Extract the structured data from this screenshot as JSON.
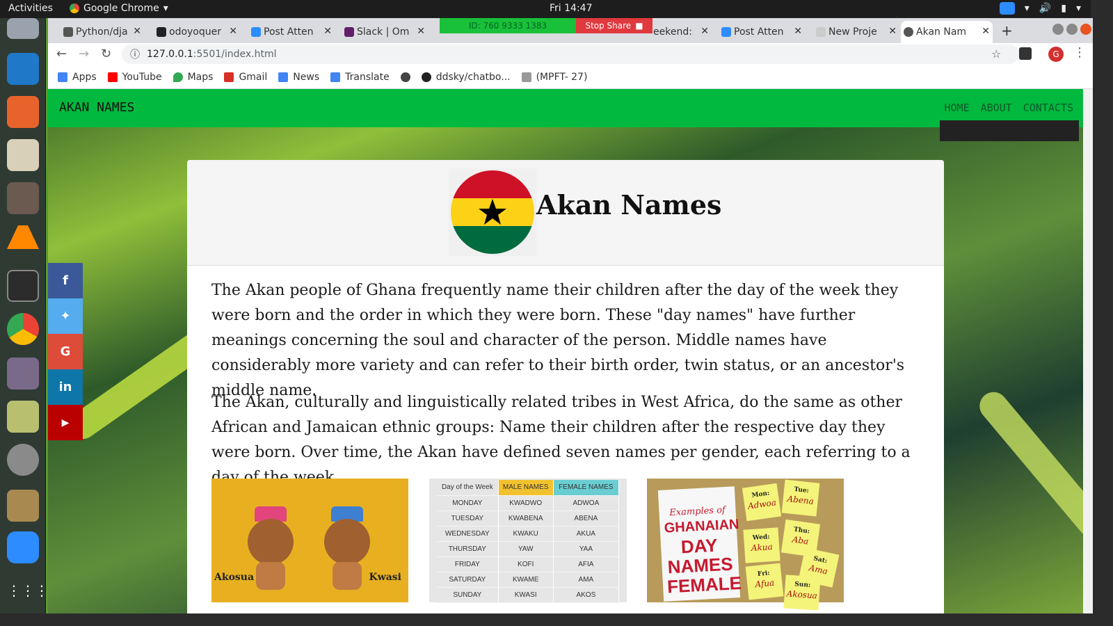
{
  "os": {
    "activities": "Activities",
    "app_name": "Google Chrome",
    "clock": "Fri 14:47"
  },
  "tabs": [
    {
      "label": "Python/dja",
      "active": false
    },
    {
      "label": "odoyoquer",
      "active": false
    },
    {
      "label": "Post Atten",
      "active": false
    },
    {
      "label": "Slack | Om",
      "active": false
    },
    {
      "label": "eekend:",
      "active": false
    },
    {
      "label": "Post Atten",
      "active": false
    },
    {
      "label": "New Proje",
      "active": false
    },
    {
      "label": "Akan Nam",
      "active": true
    }
  ],
  "screenshare": {
    "id_text": "ID: 760 9333 1383",
    "stop_label": "Stop Share"
  },
  "address": {
    "host": "127.0.0.1",
    "path": ":5501/index.html"
  },
  "profile_initial": "G",
  "bookmarks": [
    {
      "label": "Apps",
      "color": "#4285f4"
    },
    {
      "label": "YouTube",
      "color": "#ff0000"
    },
    {
      "label": "Maps",
      "color": "#34a853"
    },
    {
      "label": "Gmail",
      "color": "#d93025"
    },
    {
      "label": "News",
      "color": "#4285f4"
    },
    {
      "label": "Translate",
      "color": "#4285f4"
    },
    {
      "label": "",
      "color": "#444444"
    },
    {
      "label": "ddsky/chatbo...",
      "color": "#222222"
    },
    {
      "label": "(MPFT- 27)",
      "color": "#999999"
    }
  ],
  "site": {
    "brand": "AKAN NAMES",
    "nav": [
      "HOME",
      "ABOUT",
      "CONTACTS"
    ],
    "social": [
      {
        "icon": "facebook-icon",
        "glyph": "f",
        "color": "#3b5998"
      },
      {
        "icon": "twitter-icon",
        "glyph": "🐦",
        "color": "#55acee"
      },
      {
        "icon": "google-icon",
        "glyph": "G",
        "color": "#dd4b39"
      },
      {
        "icon": "linkedin-icon",
        "glyph": "in",
        "color": "#0e76a8"
      },
      {
        "icon": "youtube-icon",
        "glyph": "▶",
        "color": "#bb0000"
      }
    ],
    "title": "Akan Names",
    "paragraph1": "The Akan people of Ghana frequently name their children after the day of the week they were born and the order in which they were born. These \"day names\" have further meanings concerning the soul and character of the person. Middle names have considerably more variety and can refer to their birth order, twin status, or an ancestor's middle name.",
    "paragraph2": "The Akan, culturally and linguistically related tribes in West Africa, do the same as other African and Jamaican ethnic groups: Name their children after the respective day they were born. Over time, the Akan have defined seven names per gender, each referring to a day of the week.",
    "babies": [
      "Akosua",
      "Kwasi"
    ],
    "day_table": {
      "headers": [
        "Day of the Week",
        "MALE NAMES",
        "FEMALE NAMES"
      ],
      "rows": [
        [
          "MONDAY",
          "KWADWO",
          "ADWOA"
        ],
        [
          "TUESDAY",
          "KWABENA",
          "ABENA"
        ],
        [
          "WEDNESDAY",
          "KWAKU",
          "AKUA"
        ],
        [
          "THURSDAY",
          "YAW",
          "YAA"
        ],
        [
          "FRIDAY",
          "KOFI",
          "AFIA"
        ],
        [
          "SATURDAY",
          "KWAME",
          "AMA"
        ],
        [
          "SUNDAY",
          "KWASI",
          "AKOS"
        ]
      ]
    },
    "female_card": {
      "examples": "Examples of",
      "big": [
        "GHANAIAN",
        "DAY",
        "NAMES",
        "FEMALE"
      ],
      "notes": [
        {
          "day": "Mon:",
          "name": "Adwoa"
        },
        {
          "day": "Tue:",
          "name": "Abena"
        },
        {
          "day": "Wed:",
          "name": "Akua"
        },
        {
          "day": "Thu:",
          "name": "Aba"
        },
        {
          "day": "Sat:",
          "name": "Ama"
        },
        {
          "day": "Fri:",
          "name": "Afua"
        },
        {
          "day": "Sun:",
          "name": "Akosua"
        }
      ]
    }
  },
  "colors": {
    "nav_green": "#00b93e",
    "ghana_red": "#ce1126",
    "ghana_gold": "#fcd116",
    "ghana_green": "#006b3f"
  }
}
